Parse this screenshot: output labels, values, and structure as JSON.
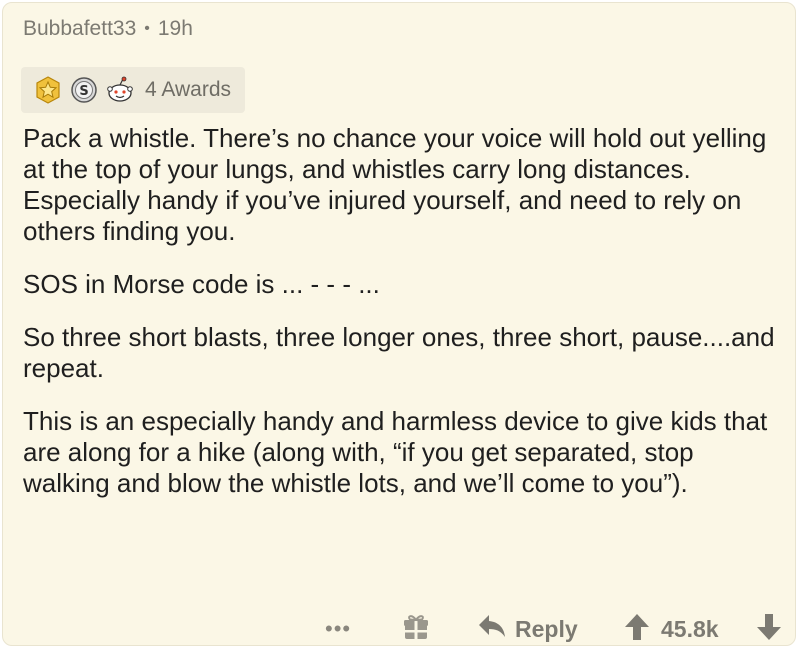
{
  "comment": {
    "author": "Bubbafett33",
    "separator": "•",
    "age": "19h",
    "awards": {
      "icons": [
        "gold-star-award-icon",
        "silver-s-award-icon",
        "snoo-award-icon"
      ],
      "label": "4 Awards"
    },
    "paragraphs": [
      "Pack a whistle. There’s no chance your voice will hold out yelling at the top of your lungs, and whistles carry long distances. Especially handy if you’ve injured yourself, and need to rely on others  finding you.",
      "SOS in Morse code is ... - - - ...",
      "So three short blasts, three longer ones, three short, pause....and repeat.",
      "This is an especially handy and harmless device to give kids that are along for a hike (along with, “if you get separated, stop walking and blow the whistle lots, and we’ll come to you”)."
    ]
  },
  "actions": {
    "more_label": "•••",
    "gift_icon": "gift-icon",
    "reply_icon": "reply-arrow-icon",
    "reply_label": "Reply",
    "upvote_icon": "upvote-arrow-icon",
    "score": "45.8k",
    "downvote_icon": "downvote-arrow-icon"
  },
  "colors": {
    "card_background": "#fbf7e6",
    "awards_background": "#eeeadb",
    "body_text": "#1f1f1f",
    "muted_text": "#7c7a72"
  }
}
